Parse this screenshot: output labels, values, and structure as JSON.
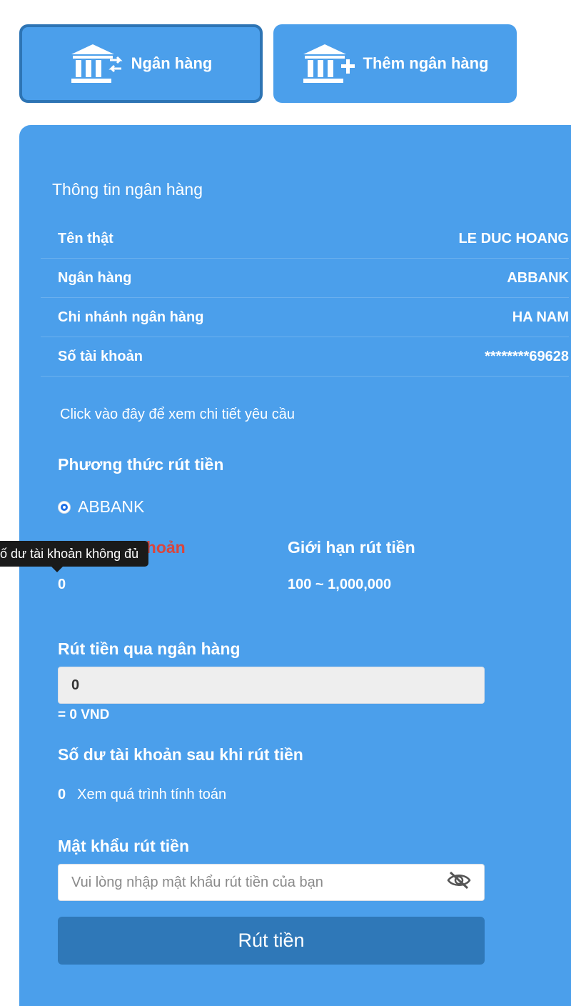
{
  "tabs": [
    {
      "label": "Ngân hàng",
      "icon": "bank-swap-icon",
      "active": true
    },
    {
      "label": "Thêm ngân hàng",
      "icon": "bank-add-icon",
      "active": false
    }
  ],
  "bank_info": {
    "title": "Thông tin ngân hàng",
    "rows": [
      {
        "label": "Tên thật",
        "value": "LE DUC HOANG"
      },
      {
        "label": "Ngân hàng",
        "value": "ABBANK"
      },
      {
        "label": "Chi nhánh ngân hàng",
        "value": "HA NAM"
      },
      {
        "label": "Số tài khoản",
        "value": "********69628"
      }
    ],
    "details_link": "Click vào đây để xem chi tiết yêu cầu"
  },
  "withdraw_method": {
    "title": "Phương thức rút tiền",
    "option": "ABBANK",
    "selected": true
  },
  "balance": {
    "label_visible": "khoản",
    "value": "0",
    "tooltip": "ố dư tài khoản không đủ"
  },
  "limit": {
    "label": "Giới hạn rút tiền",
    "value": "100 ~ 1,000,000"
  },
  "withdraw_amount": {
    "label": "Rút tiền qua ngân hàng",
    "value": "0",
    "converted": "= 0 VND"
  },
  "after_balance": {
    "label": "Số dư tài khoản sau khi rút tiền",
    "value": "0",
    "calc_link": "Xem quá trình tính toán"
  },
  "password": {
    "label": "Mật khẩu rút tiền",
    "placeholder": "Vui lòng nhập mật khẩu rút tiền của bạn",
    "toggle_icon": "eye-off-icon"
  },
  "submit_label": "Rút tiền",
  "colors": {
    "panel": "#4b9feb",
    "button": "#2f78b8",
    "warning": "#d9453d",
    "radio_accent": "#1e6fe6"
  }
}
